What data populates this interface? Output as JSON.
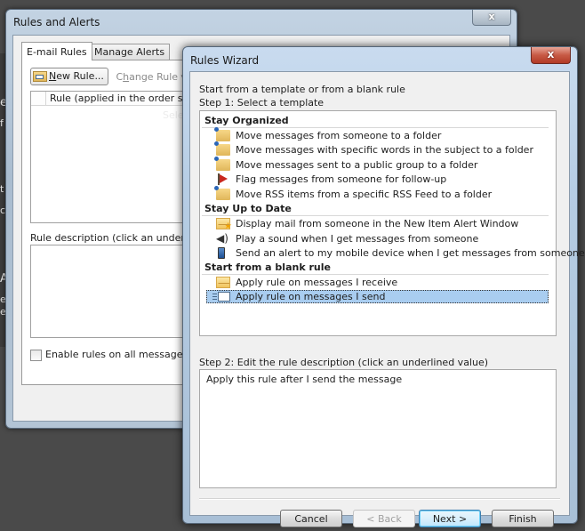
{
  "background": {
    "fragments": [
      "e",
      "f",
      "t",
      "c",
      "A",
      "e",
      "e"
    ]
  },
  "rules_and_alerts": {
    "title": "Rules and Alerts",
    "close_glyph": "x",
    "tabs": [
      {
        "label": "E-mail Rules",
        "active": true
      },
      {
        "label": "Manage Alerts",
        "active": false
      }
    ],
    "toolbar": {
      "new_rule": {
        "prefix": "",
        "mnemonic": "N",
        "rest": "ew Rule..."
      },
      "change_rule": {
        "prefix": "C",
        "mnemonic": "h",
        "rest": "ange Rule ▾"
      }
    },
    "rules_list": {
      "column_header": "Rule (applied in the order shown)",
      "ghost_text": "Selec"
    },
    "description_label": "Rule description (click an underline",
    "enable_checkbox": {
      "label": "Enable rules on all messages do",
      "checked": false
    }
  },
  "rules_wizard": {
    "title": "Rules Wizard",
    "close_glyph": "x",
    "intro": "Start from a template or from a blank rule",
    "step1_label": "Step 1: Select a template",
    "groups": [
      {
        "label": "Stay Organized",
        "items": [
          {
            "icon": "folder-move-icon",
            "label": "Move messages from someone to a folder"
          },
          {
            "icon": "folder-move-icon",
            "label": "Move messages with specific words in the subject to a folder"
          },
          {
            "icon": "folder-move-icon",
            "label": "Move messages sent to a public group to a folder"
          },
          {
            "icon": "flag-icon",
            "label": "Flag messages from someone for follow-up"
          },
          {
            "icon": "folder-move-icon",
            "label": "Move RSS items from a specific RSS Feed to a folder"
          }
        ]
      },
      {
        "label": "Stay Up to Date",
        "items": [
          {
            "icon": "mail-alert-icon",
            "label": "Display mail from someone in the New Item Alert Window"
          },
          {
            "icon": "speaker-icon",
            "label": "Play a sound when I get messages from someone"
          },
          {
            "icon": "mobile-device-icon",
            "label": "Send an alert to my mobile device when I get messages from someone"
          }
        ]
      },
      {
        "label": "Start from a blank rule",
        "items": [
          {
            "icon": "envelope-icon",
            "label": "Apply rule on messages I receive"
          },
          {
            "icon": "send-message-icon",
            "label": "Apply rule on messages I send",
            "selected": true
          }
        ]
      }
    ],
    "step2_label": "Step 2: Edit the rule description (click an underlined value)",
    "description_text": "Apply this rule after I send the message",
    "buttons": {
      "cancel": "Cancel",
      "back": "< Back",
      "next": "Next >",
      "finish": "Finish"
    }
  }
}
